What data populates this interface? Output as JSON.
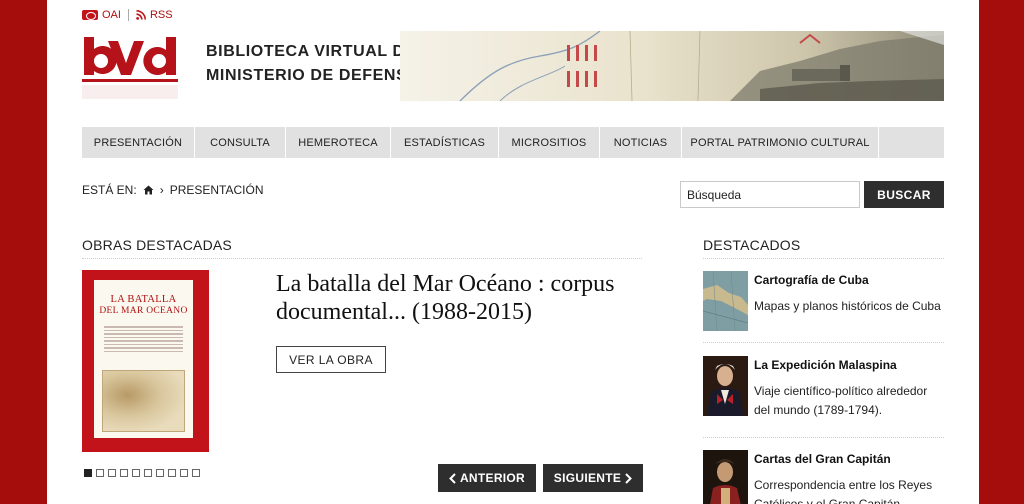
{
  "toplinks": {
    "oai": "OAI",
    "rss": "RSS"
  },
  "site": {
    "title_line1": "BIBLIOTECA VIRTUAL DEL",
    "title_line2": "MINISTERIO DE DEFENSA"
  },
  "nav": [
    {
      "label": "PRESENTACIÓN"
    },
    {
      "label": "CONSULTA"
    },
    {
      "label": "HEMEROTECA"
    },
    {
      "label": "ESTADÍSTICAS"
    },
    {
      "label": "MICROSITIOS"
    },
    {
      "label": "NOTICIAS"
    },
    {
      "label": "PORTAL PATRIMONIO CULTURAL"
    }
  ],
  "breadcrumb": {
    "prefix": "ESTÁ EN:",
    "current": "PRESENTACIÓN"
  },
  "search": {
    "value": "Búsqueda",
    "button": "BUSCAR"
  },
  "featured": {
    "section_title": "OBRAS DESTACADAS",
    "cover_title_1": "LA BATALLA",
    "cover_title_2": "DEL MAR OCEANO",
    "title": "La batalla del Mar Océano : corpus documental... (1988-2015)",
    "button": "VER LA OBRA",
    "prev": "ANTERIOR",
    "next": "SIGUIENTE",
    "active_slide": 1,
    "slide_count": 10
  },
  "destacados": {
    "section_title": "DESTACADOS",
    "items": [
      {
        "title": "Cartografía de Cuba",
        "desc": "Mapas y planos históricos de Cuba"
      },
      {
        "title": "La Expedición Malaspina",
        "desc": "Viaje científico-político alrededor del mundo (1789-1794)."
      },
      {
        "title": "Cartas del Gran Capitán",
        "desc": "Correspondencia entre los Reyes Católicos y el Gran Capitán"
      }
    ]
  },
  "colors": {
    "brand_red": "#a50d0d",
    "dark_button": "#2e2e2e",
    "nav_bg": "#e1e1e1"
  }
}
